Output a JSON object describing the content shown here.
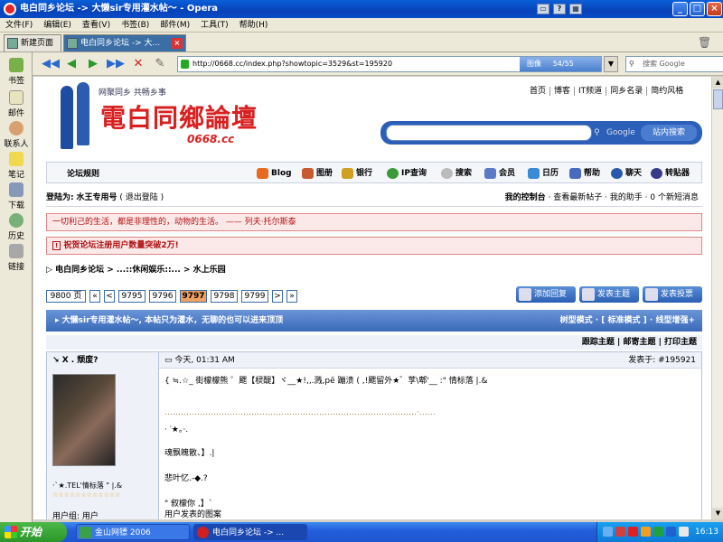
{
  "window": {
    "title": "电白同乡论坛 -> 大懒sir专用灌水帖～ - Opera"
  },
  "menu": [
    "文件(F)",
    "编辑(E)",
    "查看(V)",
    "书签(B)",
    "邮件(M)",
    "工具(T)",
    "帮助(H)"
  ],
  "tabs": [
    {
      "label": "新建页面"
    },
    {
      "label": "电白同乡论坛 -> 大..."
    }
  ],
  "address": {
    "url": "http://0668.cc/index.php?showtopic=3529&st=195920",
    "progress_label": "图像",
    "progress_count": "54/55"
  },
  "search": {
    "placeholder": "搜索 Google"
  },
  "sidepanel": [
    "书签",
    "邮件",
    "联系人",
    "笔记",
    "下载",
    "历史",
    "链接"
  ],
  "site": {
    "slogan": "网聚同乡  共畅乡事",
    "logo_text": "電白同鄉論壇",
    "logo_domain": "0668.cc",
    "toplinks": [
      "首页",
      "博客",
      "IT频道",
      "同乡名录",
      "简约风格"
    ],
    "google_label": "Google",
    "search_button": "站内搜索"
  },
  "navlinks": {
    "rules": "论坛规则",
    "items": [
      "Blog",
      "图册",
      "银行",
      "IP查询",
      "搜索",
      "会员",
      "日历",
      "帮助",
      "聊天",
      "转贴器"
    ]
  },
  "login": {
    "prefix": "登陆为:",
    "user": "水王专用号",
    "logout": "( 退出登陆 )",
    "right_bold": "我的控制台",
    "right_rest": "· 查看最新帖子 · 我的助手 · 0 个新短消息"
  },
  "quote": "一切利己的生活，都是非理性的，动物的生活。 —— 列夫·托尔斯泰",
  "announcement": "祝贺论坛注册用户数量突破2万!",
  "breadcrumb": [
    "电白同乡论坛",
    "...::休闲娱乐::...",
    "水上乐园"
  ],
  "pager": {
    "total": "9800 页",
    "first": "«",
    "prev": "<",
    "pages": [
      "9795",
      "9796",
      "9797",
      "9798",
      "9799"
    ],
    "current": "9797",
    "next": ">",
    "last": "»"
  },
  "actions": [
    "添加回复",
    "发表主题",
    "发表投票"
  ],
  "thread": {
    "title": "大懒sir专用灌水帖～, 本帖只为灌水，无聊的也可以进来顶顶",
    "modes_a": "树型模式 ·",
    "modes_b": "[ 标准模式 ]",
    "modes_c": "· 线型增强+"
  },
  "tools": "跟踪主题 | 邮寄主题 | 打印主题",
  "post": {
    "author": "X . 颓废?",
    "time": "今天, 01:31 AM",
    "number_label": "发表于: #195921",
    "signature": "·`★.TEL'情标落 \"  |.&",
    "stars": "☆☆☆☆☆☆☆☆☆☆☆☆",
    "group": "用户组: 用户",
    "lines": [
      "{ ≒.☆_ 街檬檬熊 ゜颸【棂醍】ヾ__★!,,.溅,pē 蹦溃 ( ,!颸留外★゛莩\\郫'__ :\" 情标落   |.&",
      "…………………………………………………………………………………·……",
      "·  ‵★。·.",
      "魂飘魄散、】.|",
      "悲叶忆.-◆.?",
      "\" 叙檬你 ,】`",
      "用户发表的图案"
    ]
  },
  "taskbar": {
    "start": "开始",
    "tasks": [
      "金山网镖 2006",
      "电白同乡论坛 -> ..."
    ],
    "clock": "16:13"
  },
  "colors": {
    "accent": "#3a6ea5",
    "title_bar": "#0842b8",
    "quote_red": "#b01010"
  }
}
